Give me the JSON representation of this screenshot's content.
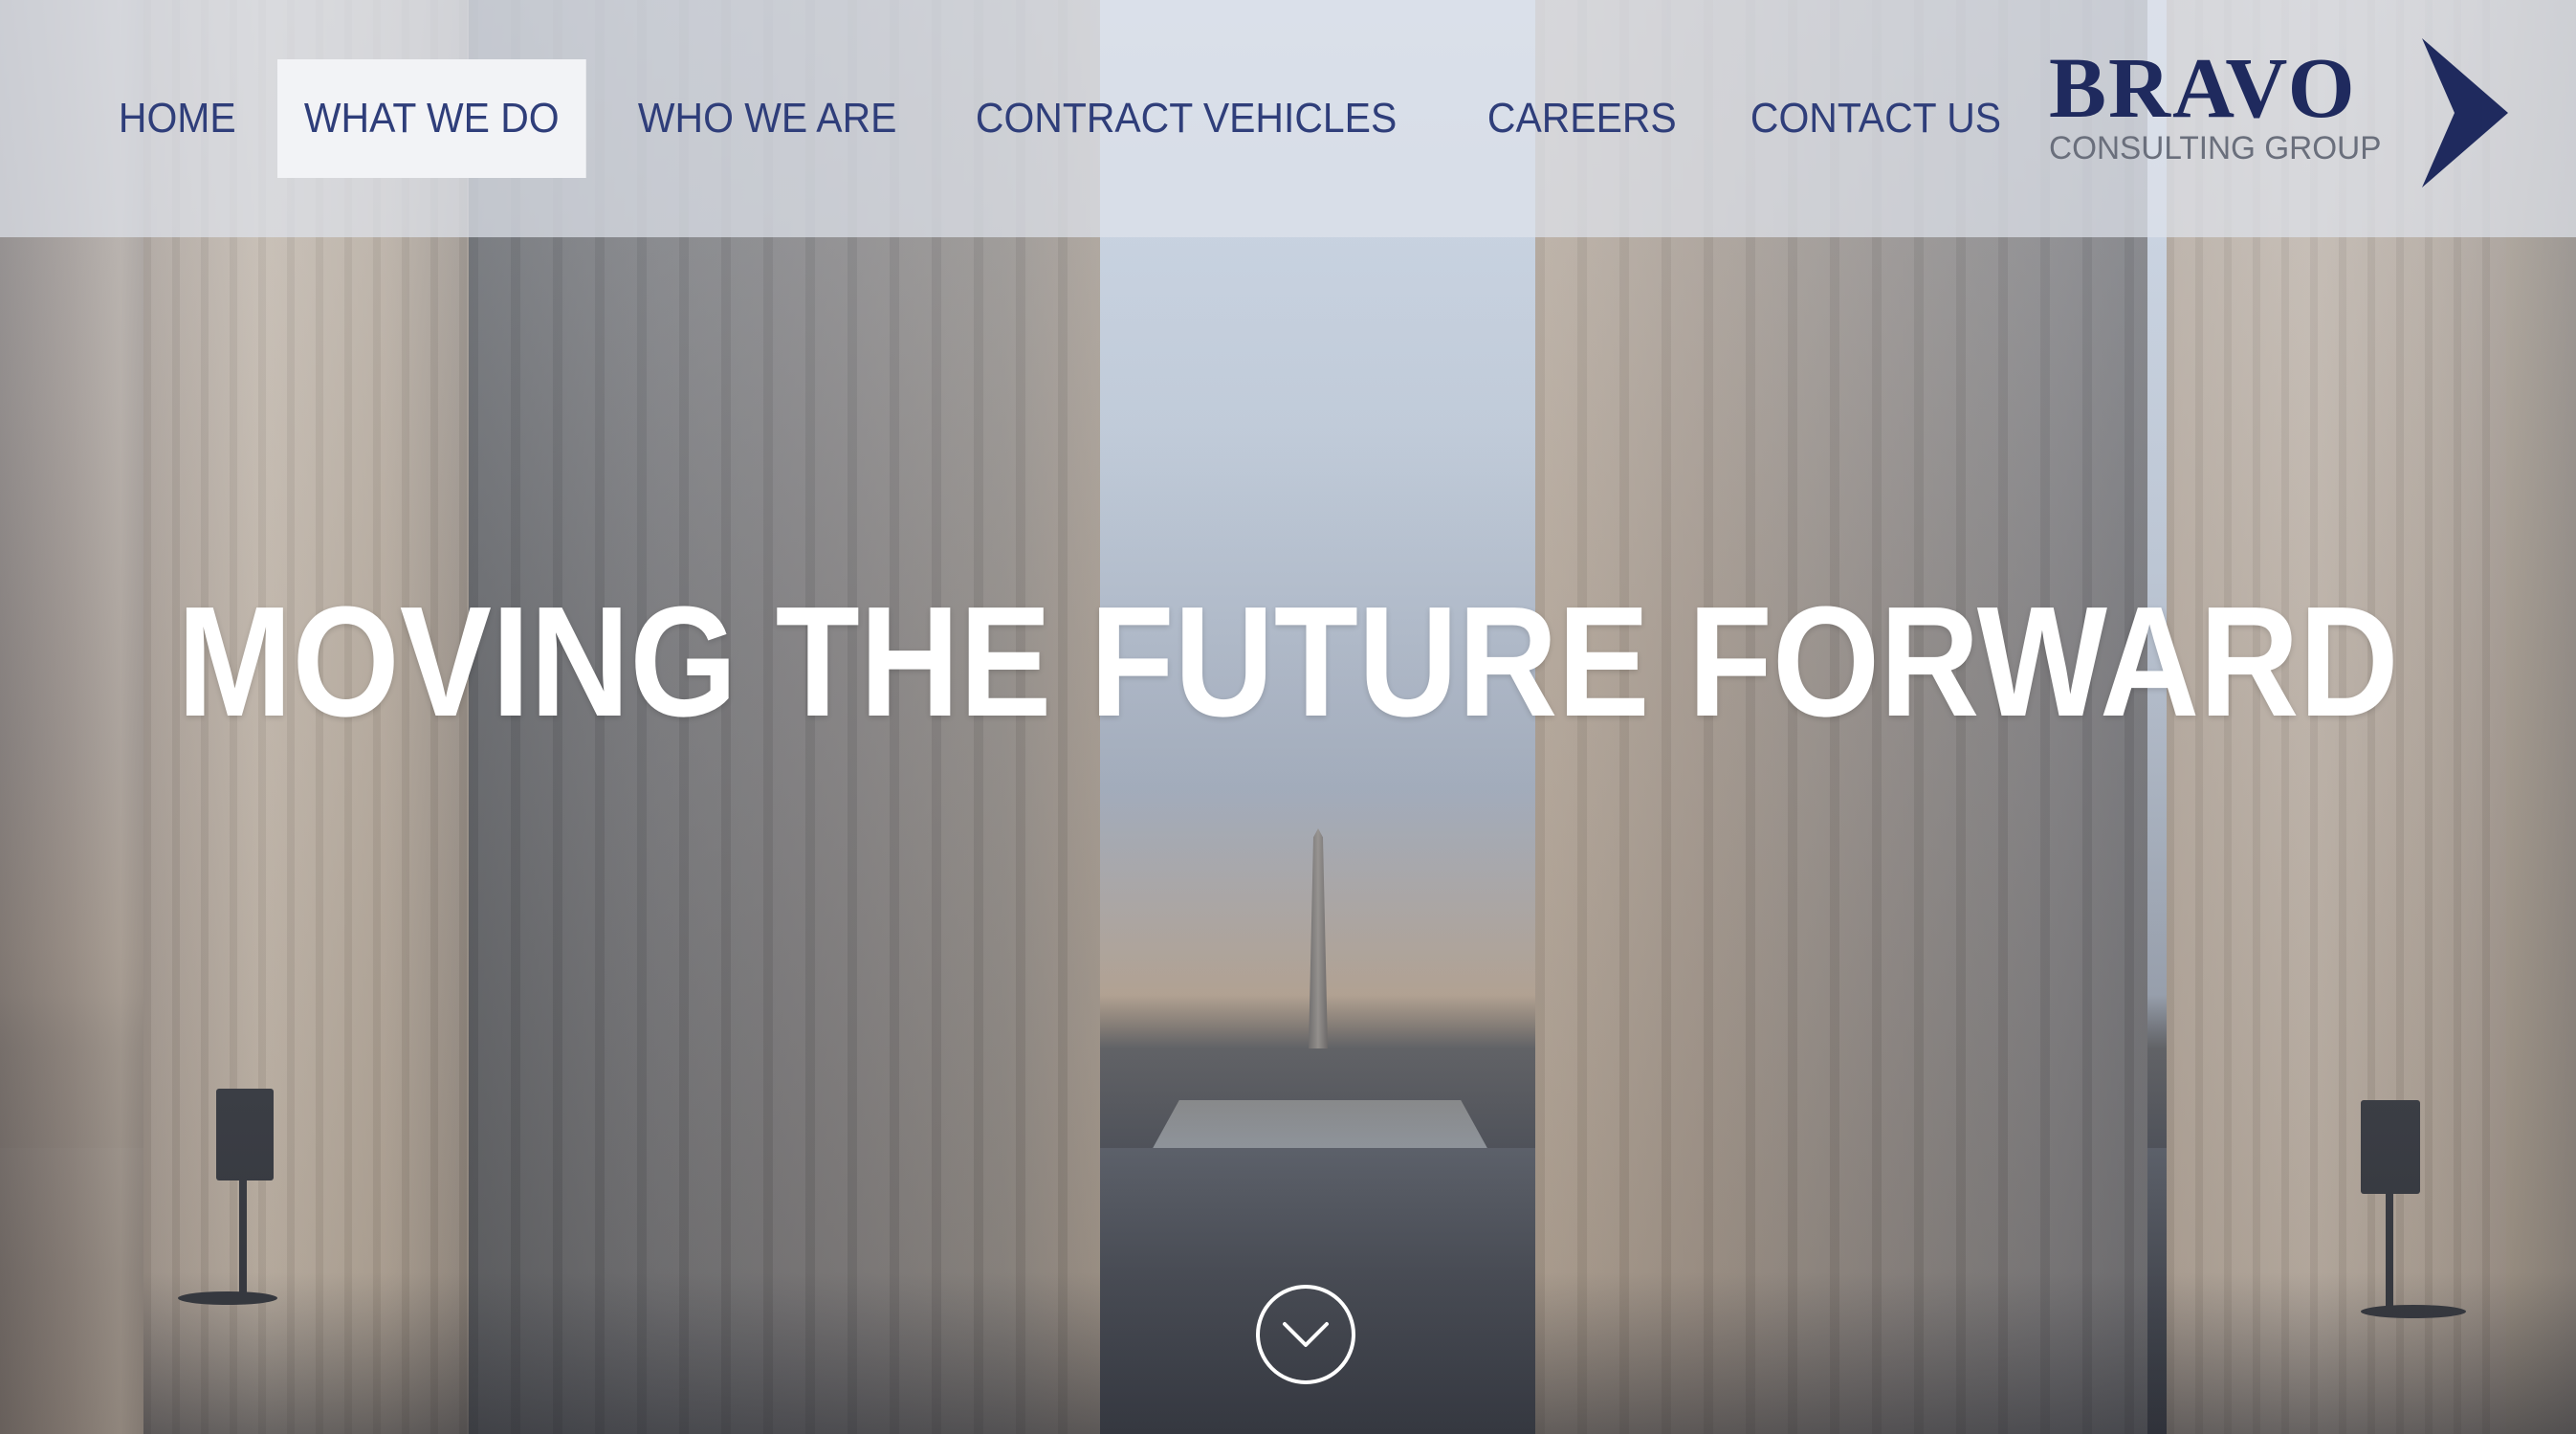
{
  "nav": {
    "items": [
      {
        "label": "HOME",
        "active": false
      },
      {
        "label": "WHAT WE DO",
        "active": true
      },
      {
        "label": "WHO WE ARE",
        "active": false
      },
      {
        "label": "CONTRACT VEHICLES",
        "active": false
      },
      {
        "label": "CAREERS",
        "active": false
      },
      {
        "label": "CONTACT US",
        "active": false
      }
    ]
  },
  "logo": {
    "word": "BRAVO",
    "tagline": "CONSULTING GROUP",
    "icon": "arrow-chevron-icon"
  },
  "hero": {
    "headline": "MOVING THE FUTURE FORWARD",
    "scroll_icon": "chevron-down-icon"
  },
  "colors": {
    "nav_text": "#2f3e7a",
    "logo_navy": "#1f2a5e",
    "headline": "#ffffff"
  }
}
